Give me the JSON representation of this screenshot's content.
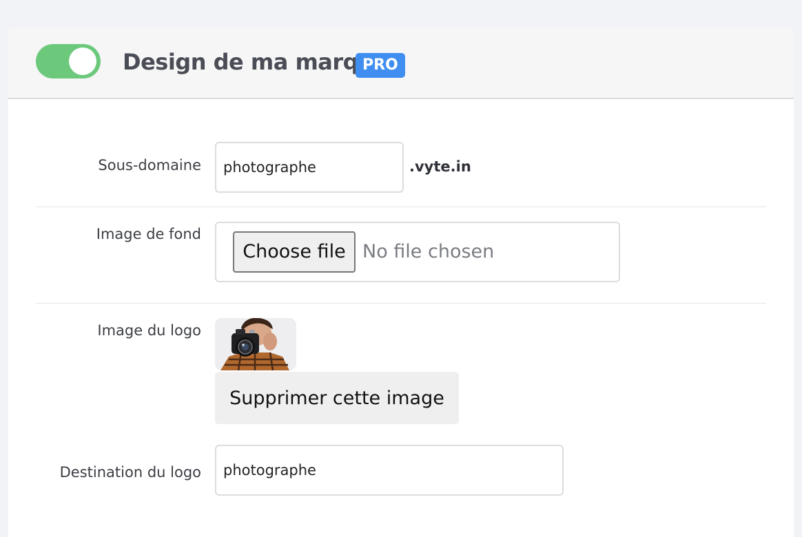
{
  "header": {
    "title": "Design de ma marque",
    "badge": "PRO",
    "toggle_on": true
  },
  "form": {
    "subdomain": {
      "label": "Sous-domaine",
      "value": "photographe",
      "suffix": ".vyte.in"
    },
    "background_image": {
      "label": "Image de fond",
      "button_label": "Choose file",
      "status": "No file chosen"
    },
    "logo_image": {
      "label": "Image du logo",
      "remove_label": "Supprimer cette image"
    },
    "logo_destination": {
      "label": "Destination du logo",
      "value": "photographe"
    }
  },
  "colors": {
    "toggle_on": "#6cc97c",
    "badge": "#3f8ef0",
    "page_background": "#f2f3f7"
  },
  "icons": {
    "logo": "photographer-with-camera-image"
  }
}
